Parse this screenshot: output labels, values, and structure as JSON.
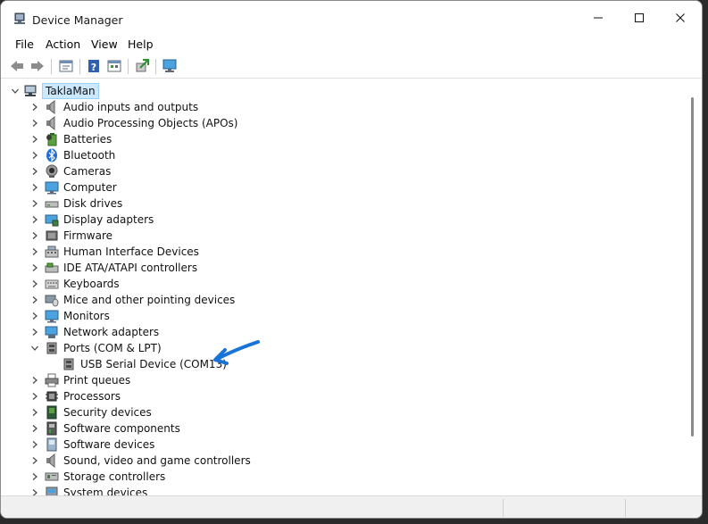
{
  "window": {
    "title": "Device Manager",
    "controls": [
      "minimize",
      "maximize",
      "close"
    ]
  },
  "menu": [
    "File",
    "Action",
    "View",
    "Help"
  ],
  "toolbar": [
    "back-icon",
    "forward-icon",
    "properties-icon",
    "help-icon",
    "show-hidden-icon",
    "update-driver-icon",
    "scan-hardware-icon"
  ],
  "tree": {
    "root": "TaklaMan",
    "categories": [
      {
        "label": "Audio inputs and outputs",
        "icon": "speaker-icon"
      },
      {
        "label": "Audio Processing Objects (APOs)",
        "icon": "speaker-icon"
      },
      {
        "label": "Batteries",
        "icon": "battery-icon"
      },
      {
        "label": "Bluetooth",
        "icon": "bluetooth-icon"
      },
      {
        "label": "Cameras",
        "icon": "camera-icon"
      },
      {
        "label": "Computer",
        "icon": "computer-icon"
      },
      {
        "label": "Disk drives",
        "icon": "disk-icon"
      },
      {
        "label": "Display adapters",
        "icon": "display-adapter-icon"
      },
      {
        "label": "Firmware",
        "icon": "firmware-icon"
      },
      {
        "label": "Human Interface Devices",
        "icon": "hid-icon"
      },
      {
        "label": "IDE ATA/ATAPI controllers",
        "icon": "ide-icon"
      },
      {
        "label": "Keyboards",
        "icon": "keyboard-icon"
      },
      {
        "label": "Mice and other pointing devices",
        "icon": "mouse-icon"
      },
      {
        "label": "Monitors",
        "icon": "monitor-icon"
      },
      {
        "label": "Network adapters",
        "icon": "network-icon"
      },
      {
        "label": "Ports (COM & LPT)",
        "icon": "port-icon",
        "expanded": true,
        "children": [
          "USB Serial Device (COM13)"
        ]
      },
      {
        "label": "Print queues",
        "icon": "printer-icon"
      },
      {
        "label": "Processors",
        "icon": "processor-icon"
      },
      {
        "label": "Security devices",
        "icon": "security-icon"
      },
      {
        "label": "Software components",
        "icon": "software-component-icon"
      },
      {
        "label": "Software devices",
        "icon": "software-device-icon"
      },
      {
        "label": "Sound, video and game controllers",
        "icon": "sound-icon"
      },
      {
        "label": "Storage controllers",
        "icon": "storage-icon"
      },
      {
        "label": "System devices",
        "icon": "system-icon"
      }
    ]
  },
  "annotation": {
    "color": "#1a73d6",
    "icon": "hand-drawn-arrow-icon"
  }
}
